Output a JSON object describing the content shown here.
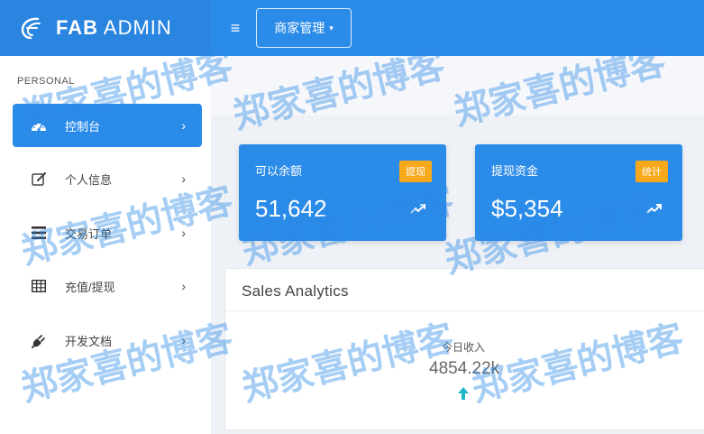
{
  "brand": {
    "bold": "FAB",
    "light": "ADMIN",
    "logo_icon": "fab-logo-icon"
  },
  "topbar": {
    "menu_icon": "≡",
    "merchant_menu_label": "商家管理",
    "caret": "▾"
  },
  "sidebar": {
    "section_label": "PERSONAL",
    "items": [
      {
        "label": "控制台",
        "icon": "dashboard-icon",
        "active": true
      },
      {
        "label": "个人信息",
        "icon": "edit-icon",
        "active": false
      },
      {
        "label": "交易订单",
        "icon": "list-icon",
        "active": false
      },
      {
        "label": "充值/提现",
        "icon": "table-icon",
        "active": false
      },
      {
        "label": "开发文档",
        "icon": "plug-icon",
        "active": false
      }
    ],
    "chevron": "›"
  },
  "cards": [
    {
      "title": "可以余额",
      "badge": "提现",
      "value": "51,642"
    },
    {
      "title": "提现资金",
      "badge": "统计",
      "value": "$5,354"
    }
  ],
  "analytics": {
    "title": "Sales Analytics",
    "stat_label": "今日收入",
    "stat_value": "4854.22k"
  },
  "watermark": {
    "text": "郑家喜的博客"
  },
  "colors": {
    "primary": "#2b8be8",
    "badge": "#f7a81b",
    "accent_arrow": "#1fb5c7"
  }
}
